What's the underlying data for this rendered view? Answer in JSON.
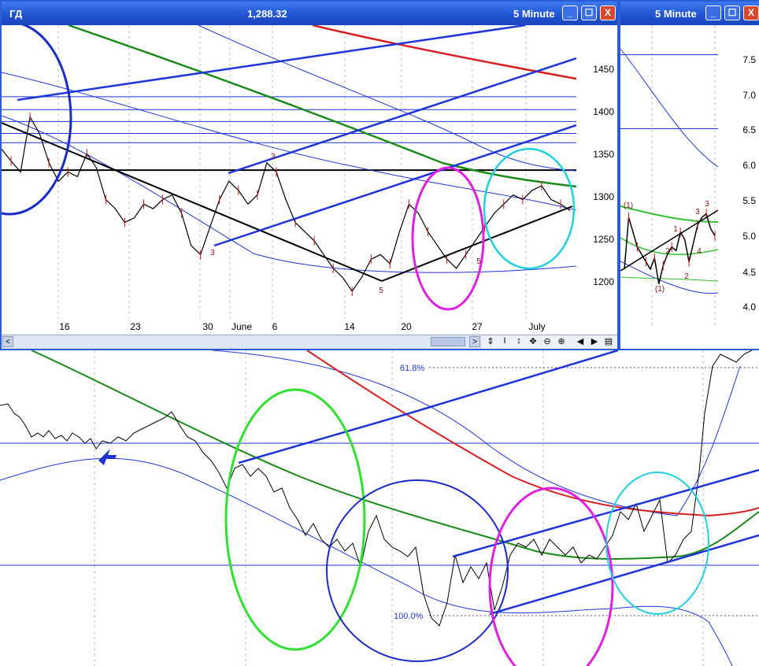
{
  "main_window": {
    "title": "ГД",
    "price": "1,288.32",
    "interval": "5 Minute",
    "buttons": {
      "minimize": "_",
      "maximize": "☐",
      "close": "X"
    },
    "price_axis": [
      "1450",
      "1400",
      "1350",
      "1300",
      "1250",
      "1200"
    ],
    "date_axis": [
      "16",
      "23",
      "30",
      "June",
      "6",
      "14",
      "20",
      "27",
      "July"
    ],
    "wave_labels": [
      "3",
      "5",
      "3",
      "5"
    ],
    "scroll_left": "<",
    "scroll_right": ">",
    "toolbar_icons": [
      "⇕",
      "I",
      "↕",
      "✥",
      "⊖",
      "⊕",
      "◀",
      "▶",
      "▤"
    ]
  },
  "side_window": {
    "interval": "5 Minute",
    "price_axis": [
      "7.5",
      "7.0",
      "6.5",
      "6.0",
      "5.5",
      "5.0",
      "4.5",
      "4.0"
    ],
    "wave_labels": [
      "(1)",
      "1",
      "2",
      "3",
      "4",
      "(1)",
      "2",
      "3"
    ]
  },
  "bottom_chart": {
    "fib_labels": [
      "61.8%",
      "100.0%"
    ]
  },
  "colors": {
    "title_bar": "#2052d0",
    "price_line": "#000000",
    "moving_avg_green": "#1a8a1a",
    "moving_avg_red": "#d62020",
    "trend_blue": "#1d35d8",
    "circle_magenta": "#e020e0",
    "circle_cyan": "#20d0e0",
    "circle_green": "#30e030",
    "circle_blue": "#1a2ac8"
  },
  "chart_data": [
    {
      "type": "line",
      "ylim": [
        1170,
        1490
      ],
      "x_tick_labels": [
        "16",
        "23",
        "30",
        "June",
        "6",
        "14",
        "20",
        "27",
        "July"
      ],
      "y_tick_labels": [
        "1450",
        "1400",
        "1350",
        "1300",
        "1250",
        "1200"
      ],
      "series": [
        {
          "values": [
            1355,
            1342,
            1330,
            1390,
            1372,
            1340,
            1320,
            1330,
            1325,
            1350,
            1335,
            1300,
            1290,
            1275,
            1280,
            1295,
            1290,
            1300,
            1305,
            1285,
            1250,
            1240,
            1270,
            1300,
            1320,
            1310,
            1295,
            1305,
            1340,
            1330,
            1300,
            1275,
            1265,
            1255,
            1240,
            1225,
            1215,
            1200,
            1215,
            1235,
            1240,
            1230,
            1265,
            1295,
            1285,
            1265,
            1250,
            1235,
            1225,
            1240,
            1255,
            1270,
            1285,
            1295,
            1305,
            1300,
            1310,
            1315,
            1300,
            1295,
            1288
          ]
        }
      ],
      "horizontal_levels": [
        1332,
        1362,
        1372,
        1385,
        1398,
        1412
      ]
    },
    {
      "type": "line",
      "ylim": [
        3.8,
        7.9
      ],
      "y_tick_labels": [
        "7.5",
        "7.0",
        "6.5",
        "6.0",
        "5.5",
        "5.0",
        "4.5",
        "4.0"
      ],
      "series": [
        {
          "values": [
            4.6,
            5.3,
            5.1,
            4.9,
            4.8,
            4.7,
            4.6,
            4.75,
            4.4,
            4.65,
            4.8,
            4.9,
            4.85,
            5.1,
            5.0,
            4.7,
            4.95,
            5.2,
            5.3,
            5.35,
            5.15,
            5.05
          ]
        }
      ]
    }
  ]
}
